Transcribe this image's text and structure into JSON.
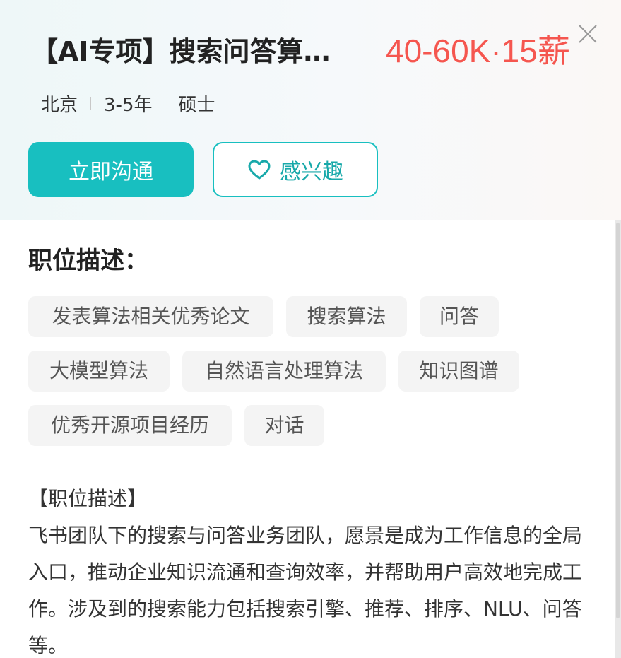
{
  "header": {
    "title": "【AI专项】搜索问答算…",
    "salary": "40-60K·15薪",
    "meta": [
      "北京",
      "3-5年",
      "硕士"
    ],
    "chat_button": "立即沟通",
    "interest_button": "感兴趣",
    "accent_color": "#18bfc0",
    "salary_color": "#f5564f",
    "close_icon": "close-icon",
    "heart_icon": "heart-icon"
  },
  "body": {
    "section_title": "职位描述：",
    "tags": [
      "发表算法相关优秀论文",
      "搜索算法",
      "问答",
      "大模型算法",
      "自然语言处理算法",
      "知识图谱",
      "优秀开源项目经历",
      "对话"
    ],
    "description_heading": "【职位描述】",
    "description_text": "飞书团队下的搜索与问答业务团队，愿景是成为工作信息的全局入口，推动企业知识流通和查询效率，并帮助用户高效地完成工作。涉及到的搜索能力包括搜索引擎、推荐、排序、NLU、问答等。"
  }
}
